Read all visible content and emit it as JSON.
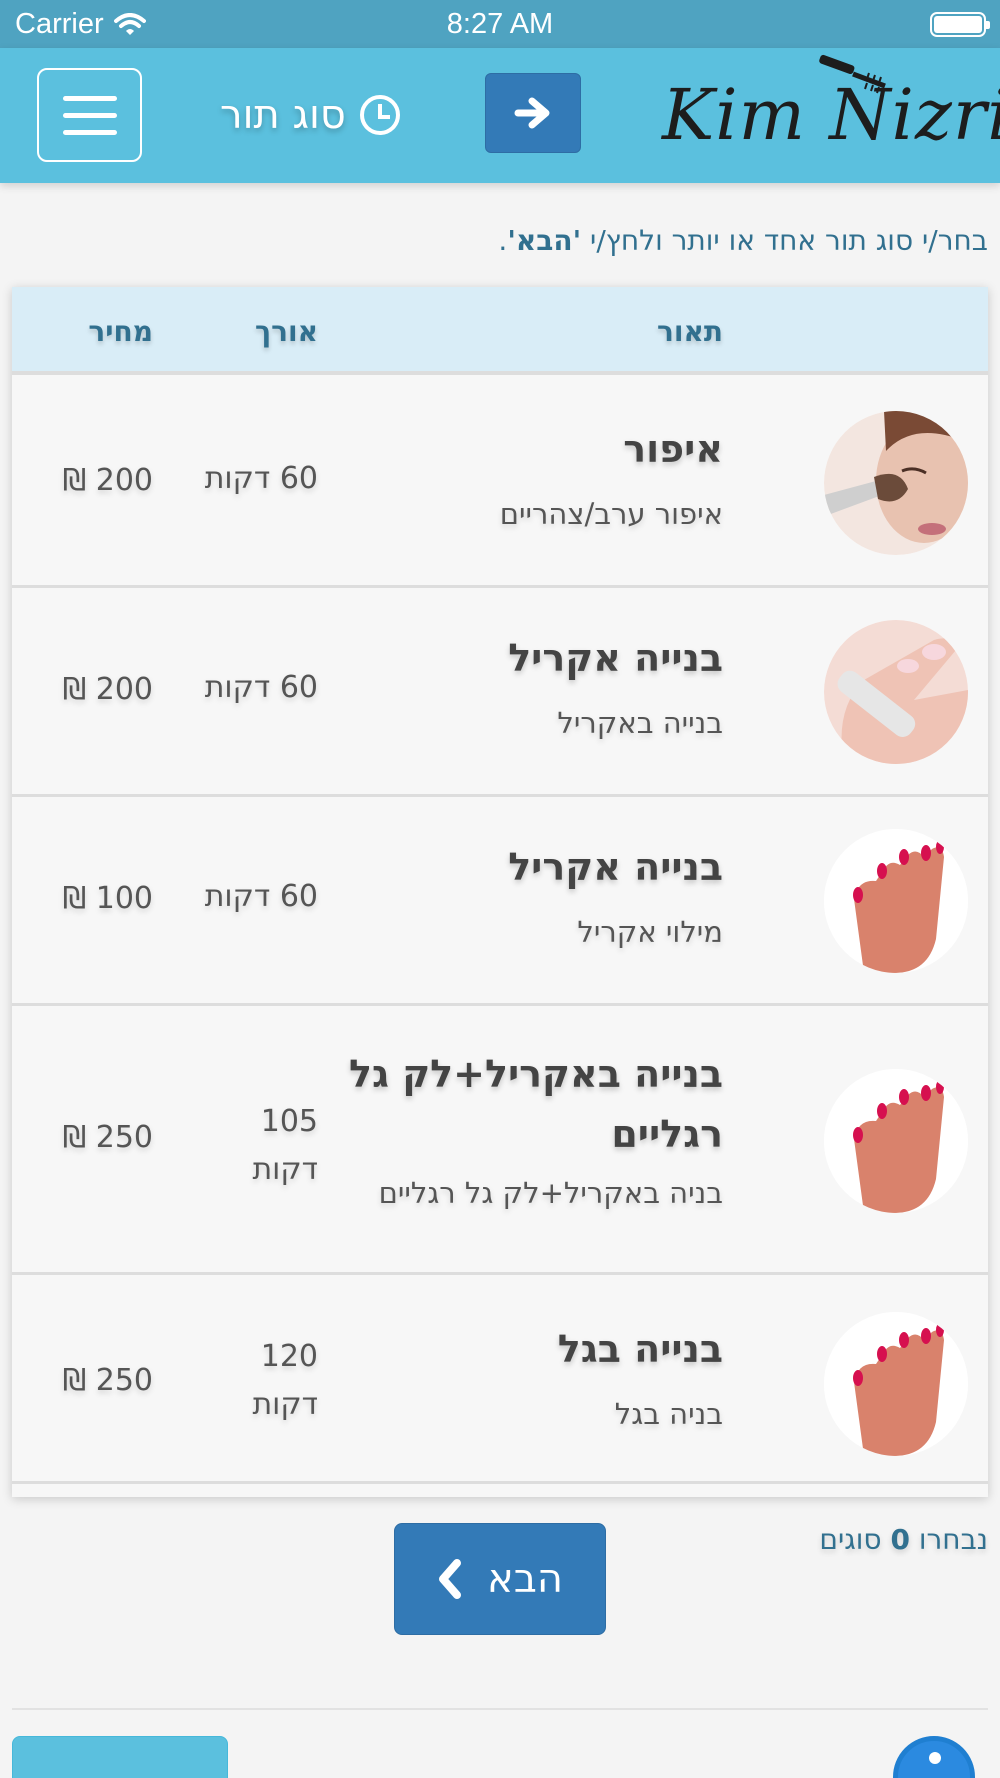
{
  "status_bar": {
    "carrier": "Carrier",
    "time": "8:27 AM"
  },
  "header": {
    "title": "סוג תור",
    "logo": "Kim Nizri",
    "menu_icon": "hamburger-icon",
    "forward_icon": "arrow-right-icon",
    "clock_icon": "clock-icon"
  },
  "instruction": {
    "prefix": "בחר/י סוג תור אחד או יותר ולחץ/י ",
    "highlight": "'הבא'",
    "suffix": "."
  },
  "table": {
    "headers": {
      "description": "תאור",
      "length": "אורך",
      "price": "מחיר"
    },
    "rows": [
      {
        "title": "איפור",
        "subtitle": "איפור ערב/צהריים",
        "length": "60 דקות",
        "price": "200 ₪",
        "image": "makeup-brush-face"
      },
      {
        "title": "בנייה אקריל",
        "subtitle": "בנייה באקריל",
        "length": "60 דקות",
        "price": "200 ₪",
        "image": "nail-file-hand"
      },
      {
        "title": "בנייה אקריל",
        "subtitle": "מילוי אקריל",
        "length": "60 דקות",
        "price": "100 ₪",
        "image": "painted-nails-hand"
      },
      {
        "title": "בנייה באקריל+לק גל רגליים",
        "subtitle": "בניה באקריל+לק גל רגליים",
        "length": "105 דקות",
        "price": "250 ₪",
        "image": "painted-nails-hand"
      },
      {
        "title": "בנייה בגל",
        "subtitle": "בניה בגל",
        "length": "120 דקות",
        "price": "250 ₪",
        "image": "painted-nails-hand"
      }
    ]
  },
  "footer": {
    "selected_prefix": "נבחרו ",
    "selected_count": "0",
    "selected_suffix": " סוגים",
    "next_label": "הבא",
    "next_icon": "chevron-left-icon",
    "info_icon": "info-icon"
  },
  "colors": {
    "header": "#5bc0de",
    "status_bar": "#4fa3c1",
    "primary": "#337ab7",
    "table_header": "#d9edf7",
    "accent_text": "#31708f"
  }
}
